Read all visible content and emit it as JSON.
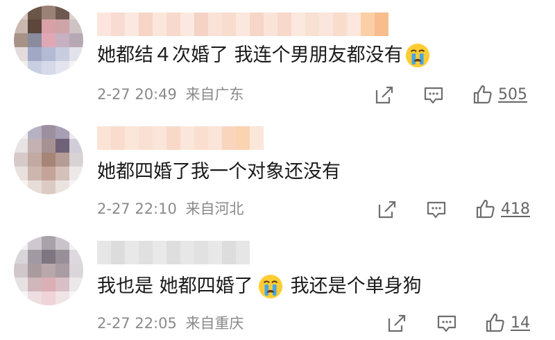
{
  "comments": [
    {
      "text_before": "她都结４次婚了  我连个男朋友都没有",
      "text_after": "",
      "emoji": "crying-face",
      "date": "2-27 20:49",
      "source": "来自广东",
      "likes": "505"
    },
    {
      "text_before": "她都四婚了我一个对象还没有",
      "text_after": "",
      "emoji": "",
      "date": "2-27 22:10",
      "source": "来自河北",
      "likes": "418"
    },
    {
      "text_before": "我也是 她都四婚了",
      "text_after": "我还是个单身狗",
      "emoji": "crying-face",
      "date": "2-27 22:05",
      "source": "来自重庆",
      "likes": "14"
    }
  ],
  "icons": {
    "share": "share-icon",
    "comment": "comment-icon",
    "like": "thumbs-up-icon"
  },
  "colors": {
    "meta_text": "#8a8a8a",
    "body_text": "#1a1a1a",
    "icon": "#6e6e6e",
    "emoji_face": "#ffcc33",
    "emoji_tear": "#45a6e8"
  }
}
